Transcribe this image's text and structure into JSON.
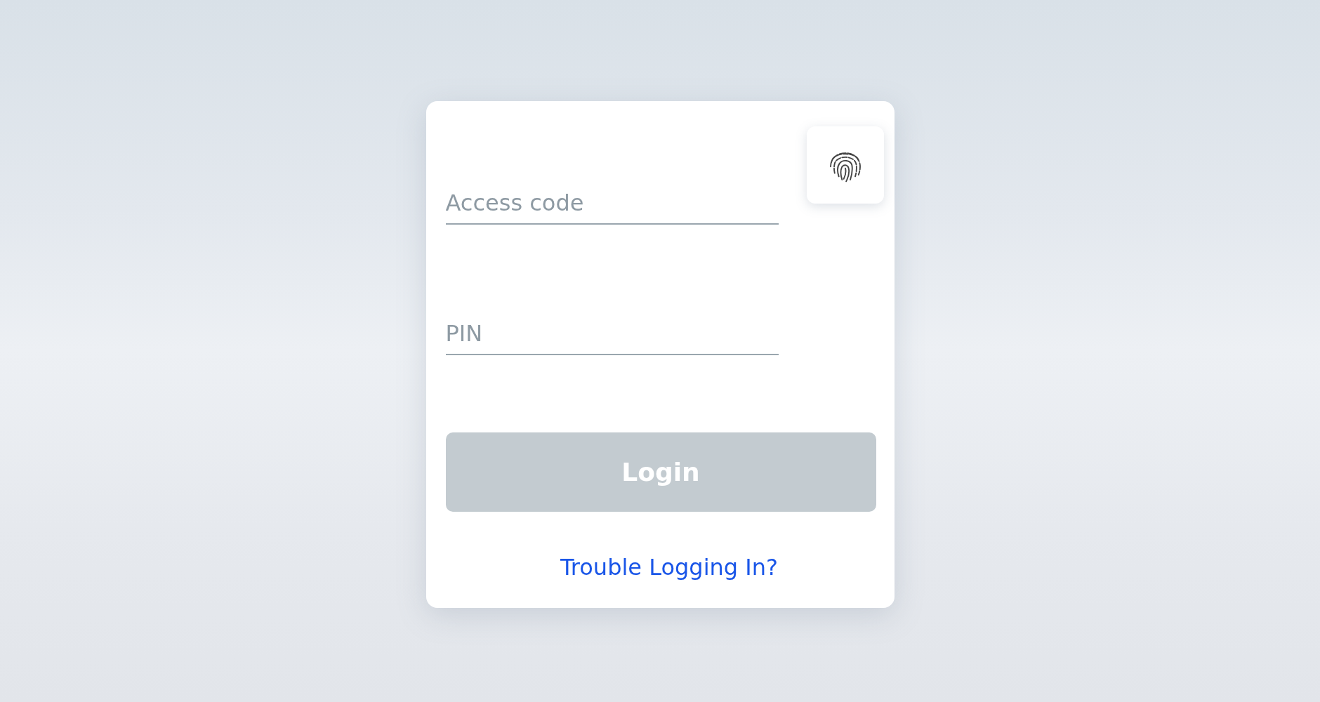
{
  "fields": [
    {
      "placeholder": "Access code"
    },
    {
      "placeholder": "PIN"
    }
  ],
  "login_button": {
    "label": "Login",
    "disabled": true
  },
  "help_link": "Trouble Logging In?"
}
